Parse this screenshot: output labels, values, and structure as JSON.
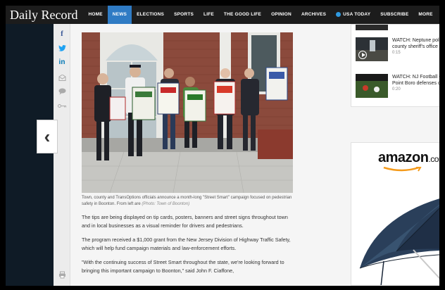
{
  "nav": {
    "logo": "Daily Record",
    "items": [
      "HOME",
      "NEWS",
      "ELECTIONS",
      "SPORTS",
      "LIFE",
      "THE GOOD LIFE",
      "OPINION",
      "ARCHIVES",
      "USA TODAY",
      "SUBSCRIBE",
      "MORE"
    ],
    "active": "NEWS"
  },
  "share": {
    "facebook": "f",
    "twitter": "✦",
    "linkedin": "in"
  },
  "article": {
    "caption": "Town, county and TransOptions officials announce a month-long \"Street Smart\" campaign focused on pedestrian safety in Boonton. From left are",
    "caption_credit": "(Photo: Town of Boonton)",
    "paragraphs": [
      "The tips are being displayed on tip cards, posters, banners and street signs throughout town and in local businesses as a visual reminder for drivers and pedestrians.",
      "The program received a $1,000 grant from the New Jersey Division of Highway Traffic Safety, which will help fund campaign materials and law-enforcement efforts.",
      "\"With the continuing success of Street Smart throughout the state, we're looking forward to bringing this important campaign to Boonton,\" said John F. Ciaffone,"
    ]
  },
  "videos": [
    {
      "title": "WATCH: Neptune police and the county sheriff's office on scene",
      "duration": "0:15"
    },
    {
      "title": "WATCH: NJ Football - Monmouth, Point Boro defenses duel",
      "duration": "0:20"
    }
  ],
  "ad": {
    "brand": "amazon",
    "brand_suffix": ".com"
  },
  "colors": {
    "nav_bg": "#1c1c1c",
    "nav_active": "#2f7bc4",
    "facebook": "#3b5998",
    "twitter": "#1da1f2",
    "linkedin": "#0077b5"
  }
}
